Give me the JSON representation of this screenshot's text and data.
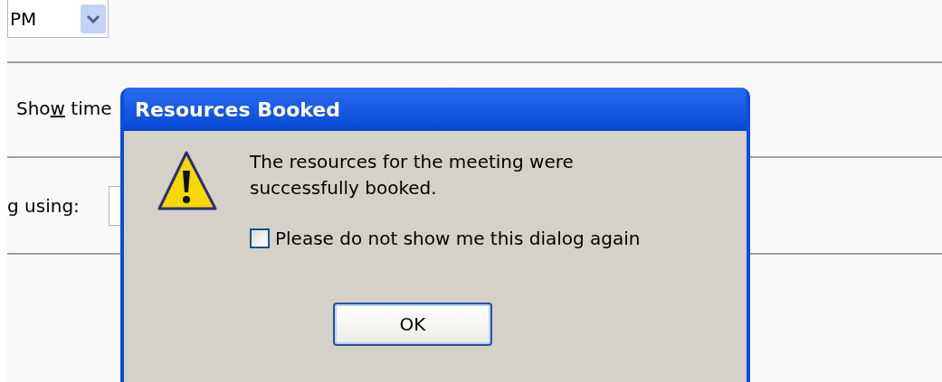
{
  "background": {
    "time_dropdown": {
      "value": "PM"
    },
    "show_time": {
      "label_before_key": "Sho",
      "access_key": "w",
      "label_after_key": " time"
    },
    "using_label": "g using:"
  },
  "dialog": {
    "title": "Resources Booked",
    "message": "The resources for the meeting were successfully booked.",
    "checkbox": {
      "label": "Please do not show me this dialog again",
      "checked": false
    },
    "button": "OK"
  }
}
